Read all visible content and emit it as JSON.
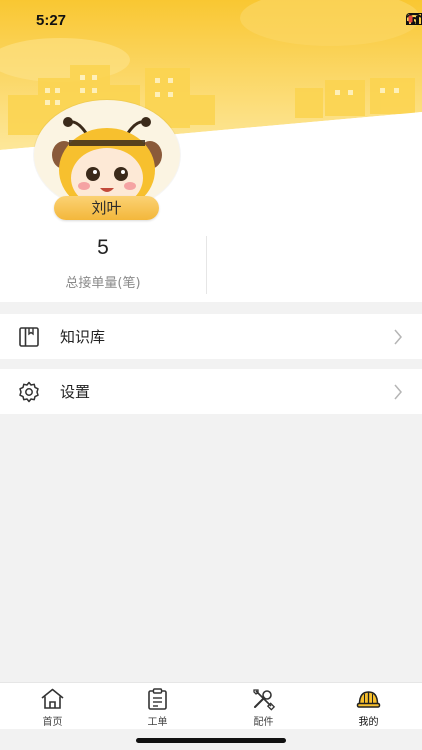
{
  "status_bar": {
    "time": "5:27",
    "battery_color": "#e0463a"
  },
  "profile": {
    "name": "刘叶"
  },
  "stats": [
    {
      "value": "5",
      "label": "总接单量(笔)"
    }
  ],
  "menu": [
    {
      "label": "知识库",
      "icon": "book-icon"
    },
    {
      "label": "设置",
      "icon": "gear-icon"
    }
  ],
  "tabbar": [
    {
      "label": "首页",
      "icon": "home-icon",
      "active": false
    },
    {
      "label": "工单",
      "icon": "clipboard-icon",
      "active": false
    },
    {
      "label": "配件",
      "icon": "tools-icon",
      "active": false
    },
    {
      "label": "我的",
      "icon": "helmet-icon",
      "active": true
    }
  ],
  "colors": {
    "accent": "#f7c02e",
    "banner_light": "#fde48a",
    "background": "#f2f2f2"
  }
}
